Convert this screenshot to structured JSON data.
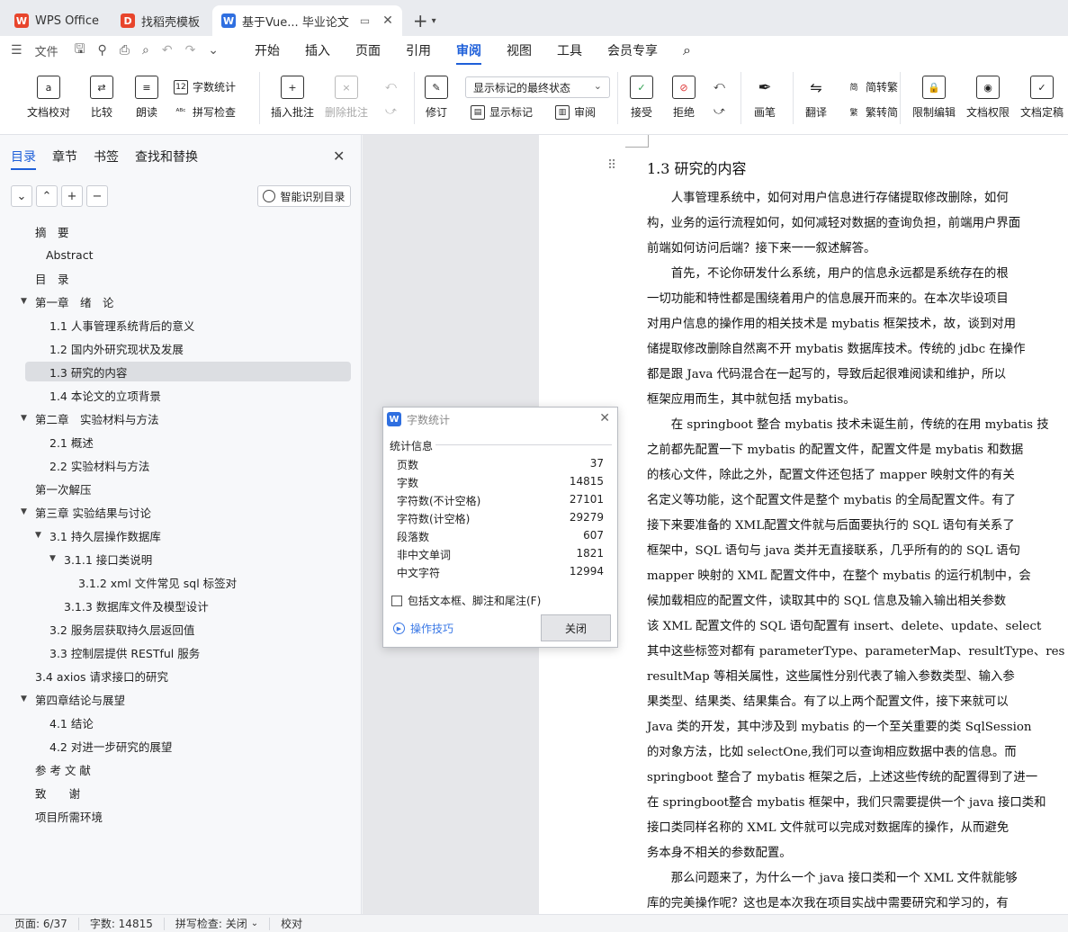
{
  "tabs": [
    {
      "label": "WPS Office",
      "icon": "wps-logo-icon",
      "color": "#e8452c"
    },
    {
      "label": "找稻壳模板",
      "icon": "docer-icon",
      "color": "#e8452c"
    },
    {
      "label": "基于Vue... 毕业论文",
      "icon": "writer-doc-icon",
      "color": "#2f6fe0",
      "active": true
    }
  ],
  "menu": {
    "file": "文件",
    "items": [
      "开始",
      "插入",
      "页面",
      "引用",
      "审阅",
      "视图",
      "工具",
      "会员专享"
    ],
    "active": "审阅"
  },
  "ribbon": {
    "doc_check": "文档校对",
    "compare": "比较",
    "read_aloud": "朗读",
    "word_count": "字数统计",
    "spell_check": "拼写检查",
    "insert_comment": "插入批注",
    "delete_comment": "删除批注",
    "track_changes": "修订",
    "markup_state": "显示标记的最终状态",
    "show_markup": "显示标记",
    "review_pane": "审阅",
    "accept": "接受",
    "reject": "拒绝",
    "pen": "画笔",
    "translate": "翻译",
    "to_traditional": "简转繁",
    "to_simplified": "繁转简",
    "restrict_edit": "限制编辑",
    "doc_permission": "文档权限",
    "doc_finalize": "文档定稿"
  },
  "nav": {
    "tabs": [
      "目录",
      "章节",
      "书签",
      "查找和替换"
    ],
    "active_tab": "目录",
    "smart_toc": "智能识别目录",
    "toc": [
      {
        "label": "摘　要",
        "level": 0
      },
      {
        "label": "Abstract",
        "level": 0.5
      },
      {
        "label": "目　录",
        "level": 0
      },
      {
        "label": "第一章　绪　论",
        "level": 0,
        "expanded": true
      },
      {
        "label": "1.1  人事管理系统背后的意义",
        "level": 1
      },
      {
        "label": "1.2  国内外研究现状及发展",
        "level": 1
      },
      {
        "label": "1.3  研究的内容",
        "level": 1,
        "selected": true
      },
      {
        "label": "1.4  本论文的立项背景",
        "level": 1
      },
      {
        "label": "第二章　实验材料与方法",
        "level": 0,
        "expanded": true
      },
      {
        "label": "2.1  概述",
        "level": 1
      },
      {
        "label": "2.2  实验材料与方法",
        "level": 1
      },
      {
        "label": "第一次解压",
        "level": 0
      },
      {
        "label": "第三章  实验结果与讨论",
        "level": 0,
        "expanded": true
      },
      {
        "label": "3.1  持久层操作数据库",
        "level": 1,
        "expanded": true
      },
      {
        "label": "3.1.1  接口类说明",
        "level": 2,
        "expanded": true
      },
      {
        "label": "3.1.2    xml 文件常见 sql 标签对",
        "level": 3
      },
      {
        "label": "3.1.3    数据库文件及模型设计",
        "level": 2
      },
      {
        "label": "3.2  服务层获取持久层返回值",
        "level": 1
      },
      {
        "label": "3.3  控制层提供 RESTful 服务",
        "level": 1
      },
      {
        "label": "3.4 axios 请求接口的研究",
        "level": 0
      },
      {
        "label": "第四章结论与展望",
        "level": 0,
        "expanded": true
      },
      {
        "label": "4.1  结论",
        "level": 1
      },
      {
        "label": "4.2  对进一步研究的展望",
        "level": 1
      },
      {
        "label": "参 考 文 献",
        "level": 0
      },
      {
        "label": "致　　谢",
        "level": 0
      },
      {
        "label": "项目所需环境",
        "level": 0
      }
    ]
  },
  "document": {
    "heading": "1.3  研究的内容",
    "lines": [
      "　　人事管理系统中，如何对用户信息进行存储提取修改删除，如何",
      "构，业务的运行流程如何，如何减轻对数据的查询负担，前端用户界面",
      "前端如何访问后端？接下来一一叙述解答。",
      "　　首先，不论你研发什么系统，用户的信息永远都是系统存在的根",
      "一切功能和特性都是围绕着用户的信息展开而来的。在本次毕设项目",
      "对用户信息的操作用的相关技术是 mybatis 框架技术，故，谈到对用",
      "储提取修改删除自然离不开 mybatis 数据库技术。传统的 jdbc 在操作",
      "都是跟 Java 代码混合在一起写的，导致后起很难阅读和维护，所以",
      "框架应用而生，其中就包括 mybatis。",
      "　　在 springboot 整合 mybatis 技术未诞生前，传统的在用 mybatis 技",
      "之前都先配置一下 mybatis 的配置文件，配置文件是 mybatis 和数据",
      "的核心文件，除此之外，配置文件还包括了 mapper 映射文件的有关",
      "名定义等功能，这个配置文件是整个 mybatis 的全局配置文件。有了",
      "接下来要准备的 XML配置文件就与后面要执行的 SQL 语句有关系了",
      "框架中，SQL 语句与 java 类并无直接联系，几乎所有的的 SQL 语句",
      "mapper 映射的 XML 配置文件中，在整个 mybatis 的运行机制中，会",
      "候加载相应的配置文件，读取其中的 SQL 信息及输入输出相关参数",
      "该 XML 配置文件的 SQL 语句配置有 insert、delete、update、select",
      "其中这些标签对都有 parameterType、parameterMap、resultType、res",
      "resultMap 等相关属性，这些属性分别代表了输入参数类型、输入参",
      "果类型、结果类、结果集合。有了以上两个配置文件，接下来就可以",
      "Java 类的开发，其中涉及到 mybatis 的一个至关重要的类 SqlSession",
      "的对象方法，比如 selectOne,我们可以查询相应数据中表的信息。而",
      "springboot 整合了 mybatis 框架之后，上述这些传统的配置得到了进一",
      "在 springboot整合 mybatis 框架中，我们只需要提供一个 java 接口类和",
      "接口类同样名称的 XML 文件就可以完成对数据库的操作，从而避免",
      "务本身不相关的参数配置。",
      "　　那么问题来了，为什么一个 java 接口类和一个 XML 文件就能够",
      "库的完美操作呢？这也是本次我在项目实战中需要研究和学习的，有"
    ]
  },
  "dialog": {
    "title": "字数统计",
    "section": "统计信息",
    "stats": [
      {
        "label": "页数",
        "value": "37"
      },
      {
        "label": "字数",
        "value": "14815"
      },
      {
        "label": "字符数(不计空格)",
        "value": "27101"
      },
      {
        "label": "字符数(计空格)",
        "value": "29279"
      },
      {
        "label": "段落数",
        "value": "607"
      },
      {
        "label": "非中文单词",
        "value": "1821"
      },
      {
        "label": "中文字符",
        "value": "12994"
      }
    ],
    "checkbox": "包括文本框、脚注和尾注(F)",
    "tips": "操作技巧",
    "close": "关闭"
  },
  "status": {
    "page": "页面: 6/37",
    "words": "字数: 14815",
    "spell": "拼写检查: 关闭",
    "proof": "校对"
  },
  "colors": {
    "accent": "#1e5fd9",
    "wps_red": "#e8452c",
    "writer_blue": "#2f6fe0"
  }
}
